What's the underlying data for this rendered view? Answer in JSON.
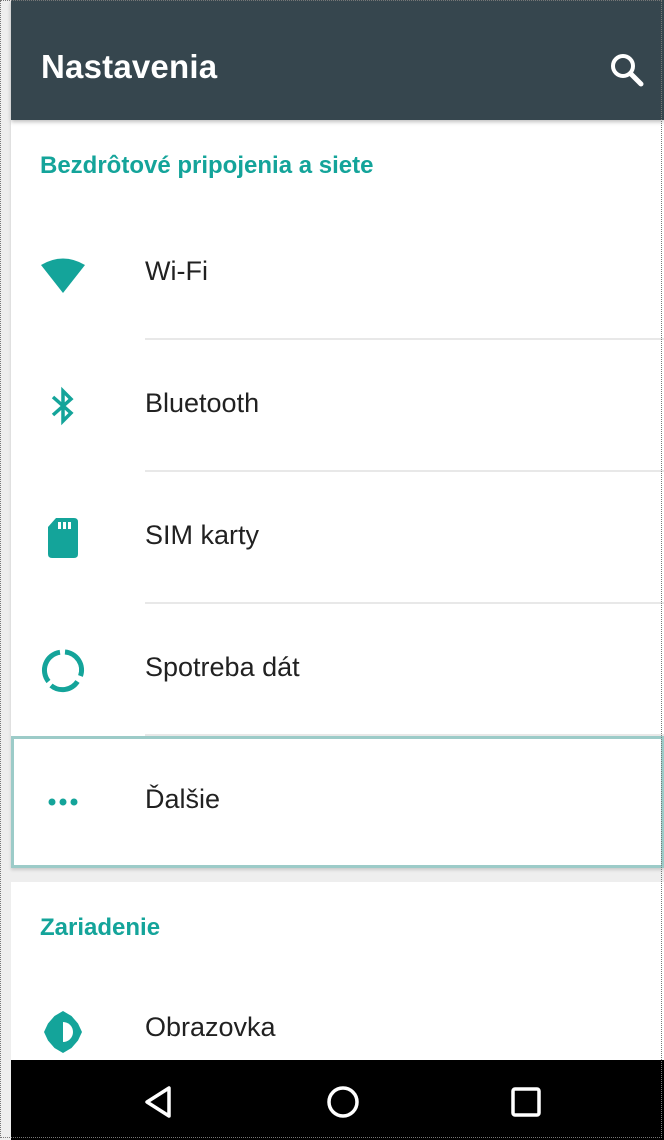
{
  "appbar": {
    "title": "Nastavenia",
    "search_icon": "search-icon"
  },
  "sections": [
    {
      "header": "Bezdrôtové pripojenia a siete",
      "items": [
        {
          "label": "Wi-Fi",
          "icon": "wifi-icon"
        },
        {
          "label": "Bluetooth",
          "icon": "bluetooth-icon"
        },
        {
          "label": "SIM karty",
          "icon": "sim-card-icon"
        },
        {
          "label": "Spotreba dát",
          "icon": "data-usage-icon"
        },
        {
          "label": "Ďalšie",
          "icon": "more-horiz-icon",
          "selected": true
        }
      ]
    },
    {
      "header": "Zariadenie",
      "items": [
        {
          "label": "Obrazovka",
          "icon": "brightness-icon"
        }
      ]
    }
  ],
  "navbar": {
    "back_icon": "back-icon",
    "home_icon": "home-icon",
    "recents_icon": "recents-icon"
  },
  "colors": {
    "appbar": "#36464e",
    "accent": "#14a49a",
    "text": "#212121",
    "background": "#eeeeee"
  }
}
